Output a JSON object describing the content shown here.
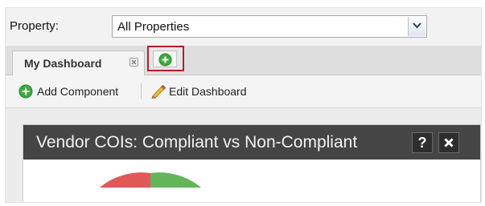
{
  "filter": {
    "label": "Property:",
    "selected": "All Properties"
  },
  "tabs": [
    {
      "label": "My Dashboard",
      "active": true
    }
  ],
  "add_tab_icon": "plus-circle-icon",
  "toolbar": {
    "add_component": "Add Component",
    "edit_dashboard": "Edit Dashboard"
  },
  "widget": {
    "title": "Vendor COIs: Compliant vs Non-Compliant",
    "help_label": "?"
  },
  "colors": {
    "tab_highlight": "#b0202b",
    "widget_header": "#454545",
    "add_green": "#3cab3c",
    "pie_red": "#e05858",
    "pie_green": "#64b45a"
  }
}
